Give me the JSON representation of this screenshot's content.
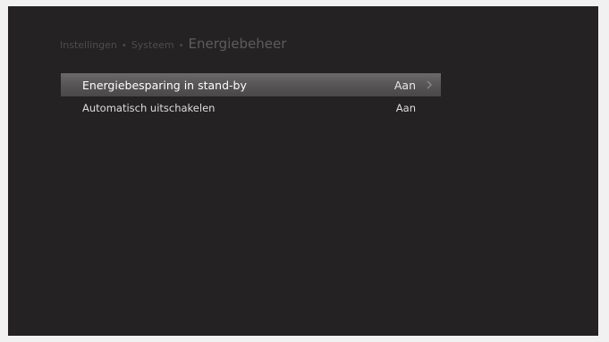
{
  "breadcrumb": {
    "items": [
      "Instellingen",
      "Systeem"
    ],
    "separator": "•",
    "current": "Energiebeheer"
  },
  "menu": {
    "items": [
      {
        "label": "Energiebesparing in stand-by",
        "value": "Aan",
        "selected": true,
        "icon": "chevron-right-icon"
      },
      {
        "label": "Automatisch uitschakelen",
        "value": "Aan",
        "selected": false
      }
    ]
  },
  "colors": {
    "screen_background": "#242222",
    "highlight": "#5a5858",
    "text": "#ffffff",
    "breadcrumb_text": "#4e4c4c"
  }
}
